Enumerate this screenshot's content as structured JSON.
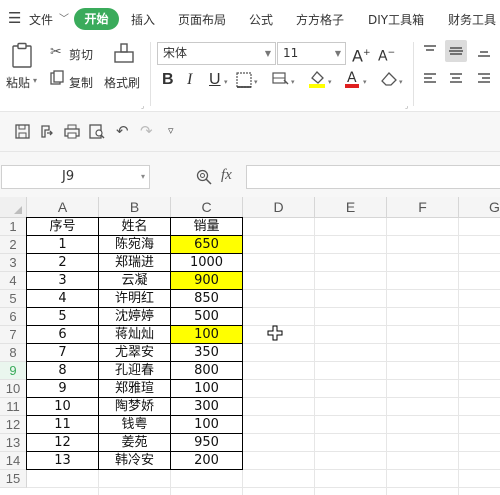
{
  "menubar": {
    "file_label": "文件",
    "tabs": [
      "开始",
      "插入",
      "页面布局",
      "公式",
      "方方格子",
      "DIY工具箱",
      "财务工具"
    ]
  },
  "ribbon": {
    "paste_label": "粘贴",
    "cut_label": "剪切",
    "copy_label": "复制",
    "format_painter_label": "格式刷",
    "font_name": "宋体",
    "font_size": "11"
  },
  "formula_bar": {
    "cell_ref": "J9",
    "fx": "fx",
    "formula": ""
  },
  "sheet": {
    "columns": [
      "A",
      "B",
      "C",
      "D",
      "E",
      "F",
      "G"
    ],
    "rows": [
      "1",
      "2",
      "3",
      "4",
      "5",
      "6",
      "7",
      "8",
      "9",
      "10",
      "11",
      "12",
      "13",
      "14",
      "15"
    ],
    "headers": [
      "序号",
      "姓名",
      "销量"
    ],
    "data": [
      {
        "no": "1",
        "name": "陈宛海",
        "sales": "650"
      },
      {
        "no": "2",
        "name": "郑瑞进",
        "sales": "1000"
      },
      {
        "no": "3",
        "name": "云凝",
        "sales": "900"
      },
      {
        "no": "4",
        "name": "许明红",
        "sales": "850"
      },
      {
        "no": "5",
        "name": "沈婷婷",
        "sales": "500"
      },
      {
        "no": "6",
        "name": "蒋灿灿",
        "sales": "100"
      },
      {
        "no": "7",
        "name": "尤翠安",
        "sales": "350"
      },
      {
        "no": "8",
        "name": "孔迎春",
        "sales": "800"
      },
      {
        "no": "9",
        "name": "郑雅瑄",
        "sales": "100"
      },
      {
        "no": "10",
        "name": "陶梦娇",
        "sales": "300"
      },
      {
        "no": "11",
        "name": "钱粤",
        "sales": "100"
      },
      {
        "no": "12",
        "name": "姜苑",
        "sales": "950"
      },
      {
        "no": "13",
        "name": "韩冷安",
        "sales": "200"
      }
    ],
    "highlight_color": "#ffff00",
    "highlighted_sales_rows": [
      2,
      4,
      7
    ],
    "active_row": "9"
  },
  "colors": {
    "accent": "#3aab5b",
    "grid_line": "#e6e6e6",
    "header_bg": "#f5f5f5"
  }
}
